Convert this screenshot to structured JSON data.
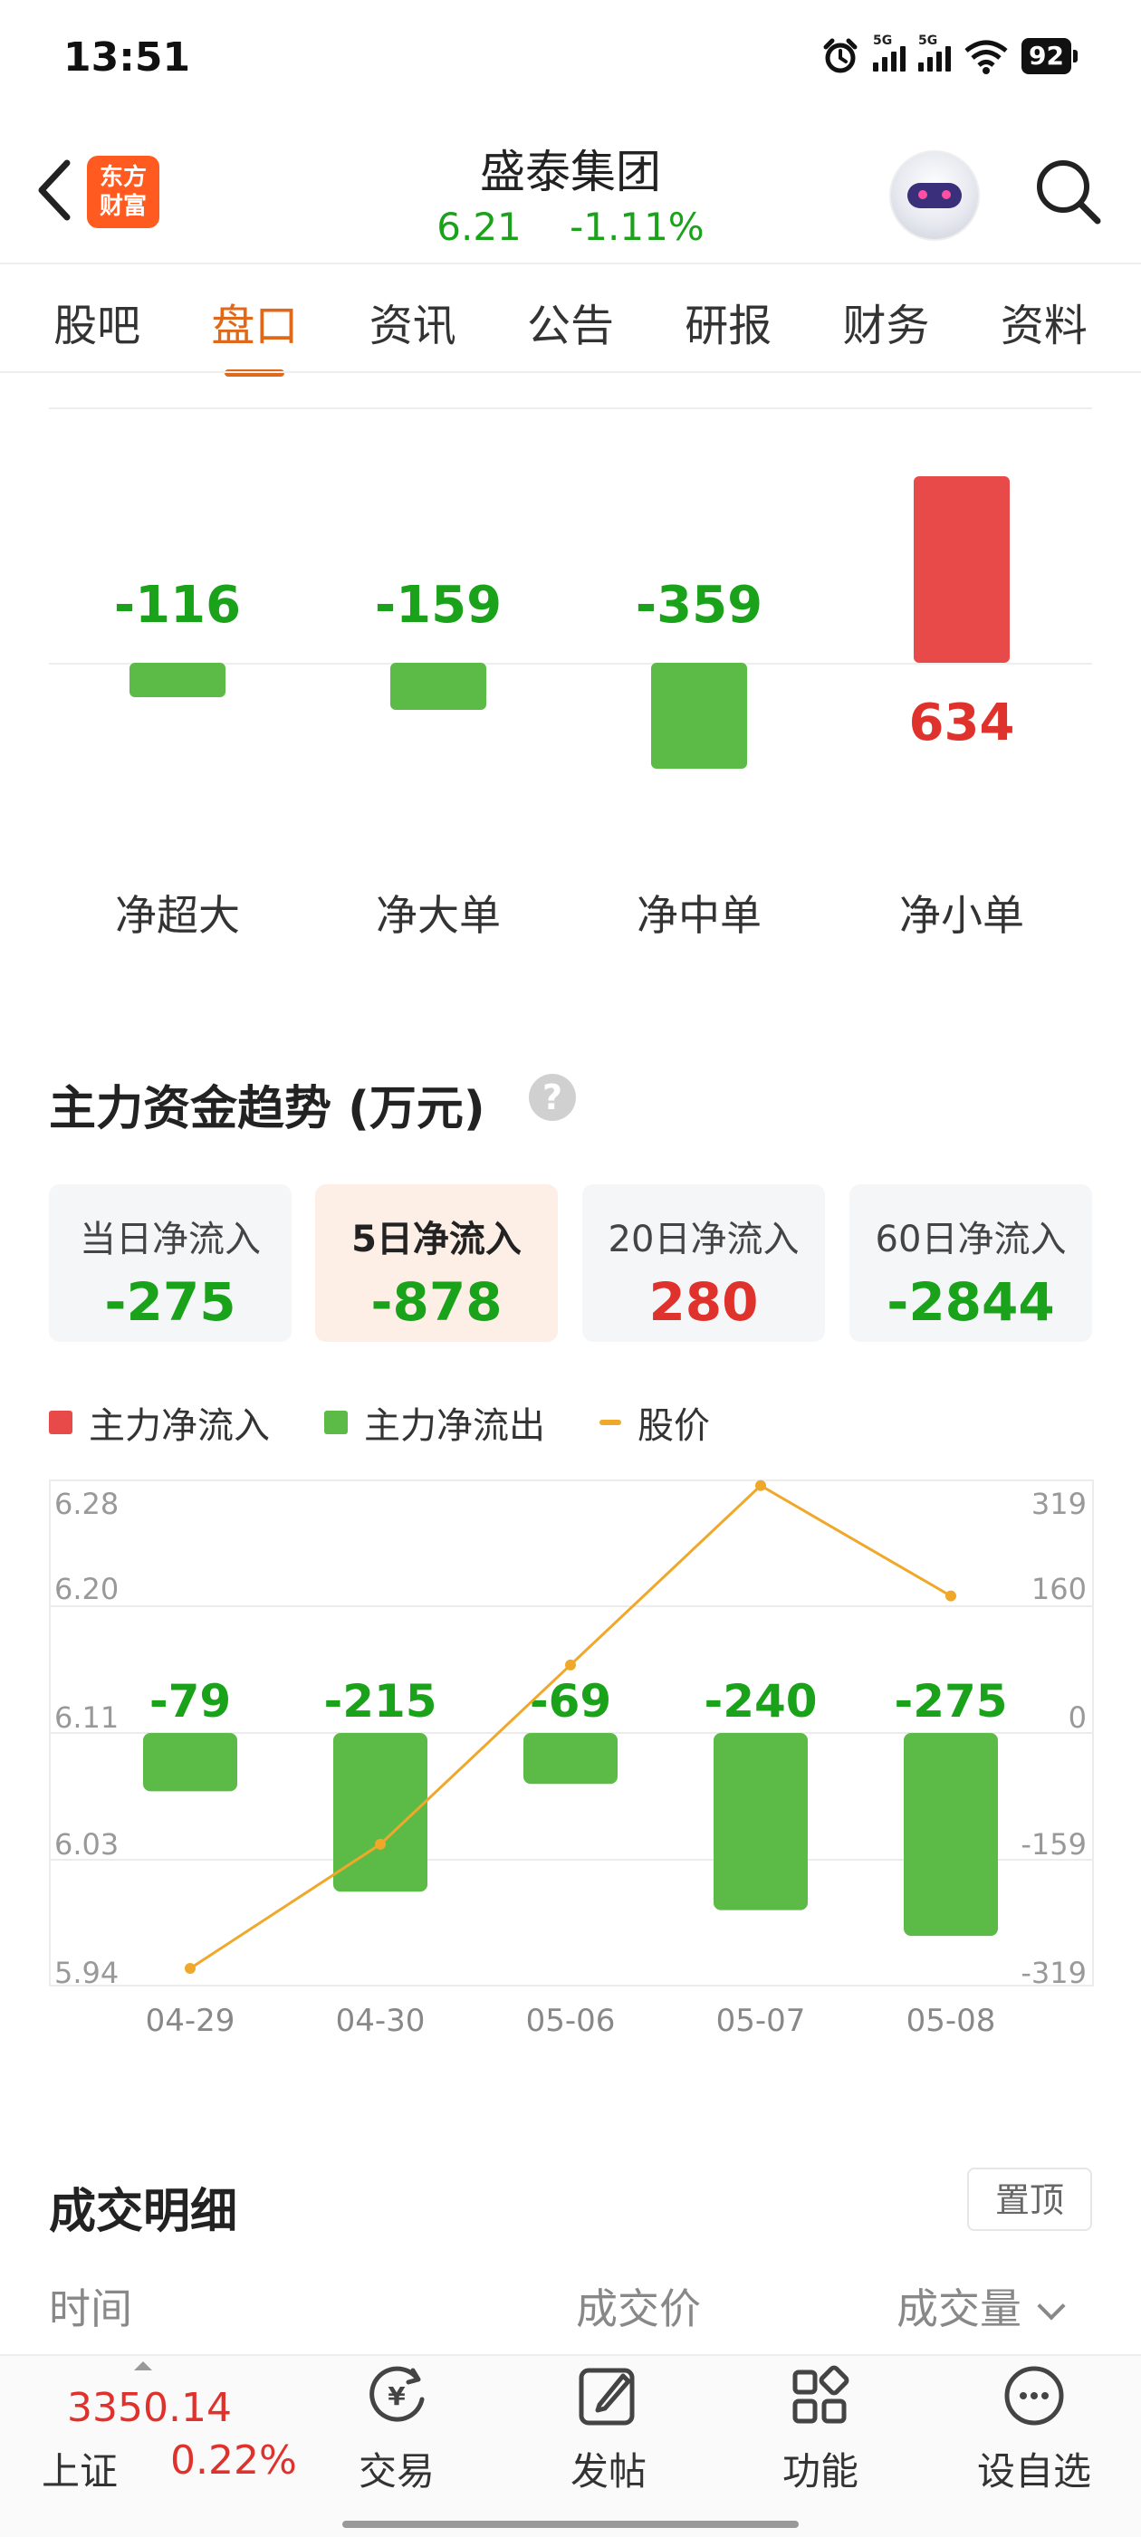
{
  "status_bar": {
    "time": "13:51",
    "battery": "92",
    "net1": "5G",
    "net2": "5G"
  },
  "header": {
    "logo_line1": "东方",
    "logo_line2": "财富",
    "title": "盛泰集团",
    "price": "6.21",
    "change_pct": "-1.11%"
  },
  "tabs": [
    "股吧",
    "盘口",
    "资讯",
    "公告",
    "研报",
    "财务",
    "资料"
  ],
  "active_tab": "盘口",
  "net_flow": {
    "items": [
      {
        "label": "净超大",
        "value": "-116",
        "num": -116
      },
      {
        "label": "净大单",
        "value": "-159",
        "num": -159
      },
      {
        "label": "净中单",
        "value": "-359",
        "num": -359
      },
      {
        "label": "净小单",
        "value": "634",
        "num": 634
      }
    ]
  },
  "trend": {
    "title": "主力资金趋势 (万元)",
    "help": "?",
    "cards": [
      {
        "label": "当日净流入",
        "value": "-275",
        "color": "#1aa21a"
      },
      {
        "label": "5日净流入",
        "value": "-878",
        "color": "#1aa21a"
      },
      {
        "label": "20日净流入",
        "value": "280",
        "color": "#e0322c"
      },
      {
        "label": "60日净流入",
        "value": "-2844",
        "color": "#1aa21a"
      }
    ],
    "legend": {
      "inflow": "主力净流入",
      "outflow": "主力净流出",
      "price": "股价"
    }
  },
  "chart_data": {
    "type": "bar",
    "categories": [
      "04-29",
      "04-30",
      "05-06",
      "05-07",
      "05-08"
    ],
    "series": [
      {
        "name": "主力净流出",
        "values": [
          -79,
          -215,
          -69,
          -240,
          -275
        ],
        "labels": [
          "-79",
          "-215",
          "-69",
          "-240",
          "-275"
        ],
        "color": "#5cbb46"
      },
      {
        "name": "股价",
        "type": "line",
        "values": [
          5.94,
          6.03,
          6.16,
          6.29,
          6.21
        ],
        "color": "#f0a82a"
      }
    ],
    "left_axis_ticks": [
      "6.28",
      "6.20",
      "6.11",
      "6.03",
      "5.94"
    ],
    "right_axis_ticks": [
      "319",
      "160",
      "0",
      "-159",
      "-319"
    ],
    "left_ylim": [
      5.94,
      6.28
    ],
    "right_ylim": [
      -319,
      319
    ],
    "grid": true
  },
  "deals": {
    "title": "成交明细",
    "pin_label": "置顶",
    "col_time": "时间",
    "col_price": "成交价",
    "col_volume": "成交量"
  },
  "bottom": {
    "index_value": "3350.14",
    "index_name": "上证",
    "index_pct": "0.22%",
    "nav": [
      "交易",
      "发帖",
      "功能",
      "设自选"
    ]
  }
}
